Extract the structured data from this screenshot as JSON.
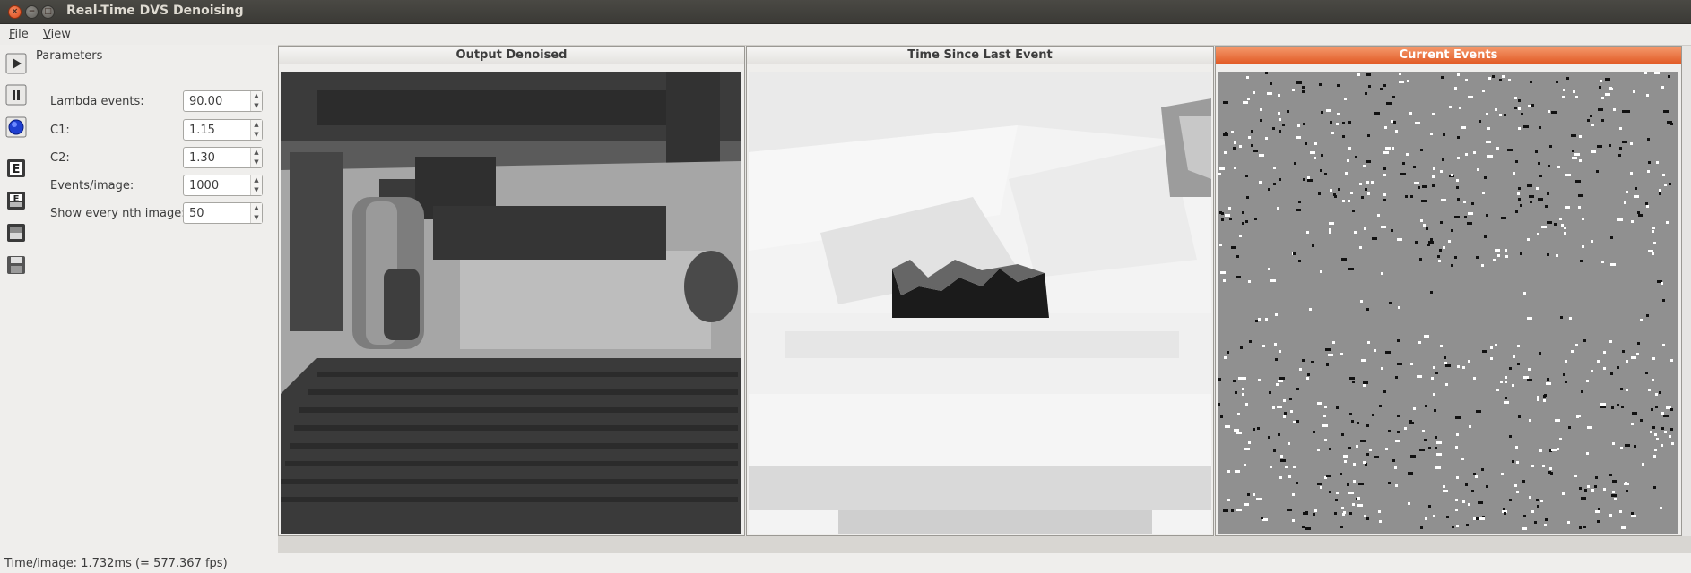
{
  "window": {
    "title": "Real-Time DVS Denoising",
    "controls": {
      "close_glyph": "×",
      "min_glyph": "−",
      "max_glyph": "□"
    }
  },
  "menubar": {
    "file": {
      "mnemonic": "F",
      "rest": "ile"
    },
    "view": {
      "mnemonic": "V",
      "rest": "iew"
    }
  },
  "toolbar": {
    "buttons": [
      {
        "icon": "play-icon"
      },
      {
        "icon": "pause-icon"
      },
      {
        "icon": "record-icon"
      },
      {
        "icon": "events-icon"
      },
      {
        "icon": "events-image-icon"
      },
      {
        "icon": "image-icon"
      },
      {
        "icon": "save-icon"
      }
    ]
  },
  "parameters": {
    "title": "Parameters",
    "fields": [
      {
        "label": "Lambda events:",
        "value": "90.00"
      },
      {
        "label": "C1:",
        "value": "1.15"
      },
      {
        "label": "C2:",
        "value": "1.30"
      },
      {
        "label": "Events/image:",
        "value": "1000"
      },
      {
        "label": "Show every nth image:",
        "value": "50"
      }
    ]
  },
  "panels": [
    {
      "title": "Output Denoised",
      "active": false
    },
    {
      "title": "Time Since Last Event",
      "active": false
    },
    {
      "title": "Current Events",
      "active": true
    }
  ],
  "colors": {
    "accent": "#e8693a",
    "event_background": "#909090"
  },
  "status": {
    "text": "Time/image: 1.732ms (= 577.367 fps)"
  }
}
